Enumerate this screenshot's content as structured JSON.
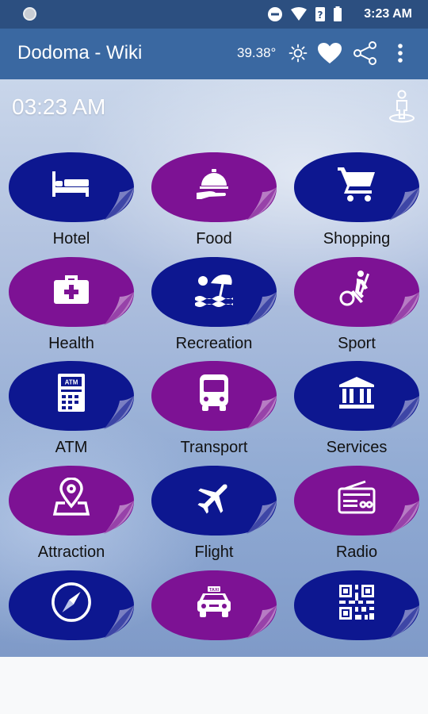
{
  "status_bar": {
    "time": "3:23 AM"
  },
  "app_bar": {
    "title": "Dodoma - Wiki",
    "temperature": "39.38°"
  },
  "main": {
    "clock": "03:23 AM"
  },
  "grid": {
    "tiles": [
      {
        "label": "Hotel",
        "color": "#0d1790",
        "icon": "bed-icon"
      },
      {
        "label": "Food",
        "color": "#7d1294",
        "icon": "food-service-icon"
      },
      {
        "label": "Shopping",
        "color": "#0d1790",
        "icon": "shopping-cart-icon"
      },
      {
        "label": "Health",
        "color": "#7d1294",
        "icon": "first-aid-kit-icon"
      },
      {
        "label": "Recreation",
        "color": "#0d1790",
        "icon": "beach-umbrella-icon"
      },
      {
        "label": "Sport",
        "color": "#7d1294",
        "icon": "elliptical-trainer-icon"
      },
      {
        "label": "ATM",
        "color": "#0d1790",
        "icon": "atm-icon"
      },
      {
        "label": "Transport",
        "color": "#7d1294",
        "icon": "bus-icon"
      },
      {
        "label": "Services",
        "color": "#0d1790",
        "icon": "bank-building-icon"
      },
      {
        "label": "Attraction",
        "color": "#7d1294",
        "icon": "map-pin-icon"
      },
      {
        "label": "Flight",
        "color": "#0d1790",
        "icon": "airplane-icon"
      },
      {
        "label": "Radio",
        "color": "#7d1294",
        "icon": "radio-icon"
      },
      {
        "label": "",
        "color": "#0d1790",
        "icon": "compass-icon"
      },
      {
        "label": "",
        "color": "#7d1294",
        "icon": "taxi-icon"
      },
      {
        "label": "",
        "color": "#0d1790",
        "icon": "qr-code-icon"
      }
    ]
  },
  "colors": {
    "status_bar": "#2c4f80",
    "app_bar": "#3a68a1",
    "blue_tile": "#0d1790",
    "purple_tile": "#7d1294"
  }
}
